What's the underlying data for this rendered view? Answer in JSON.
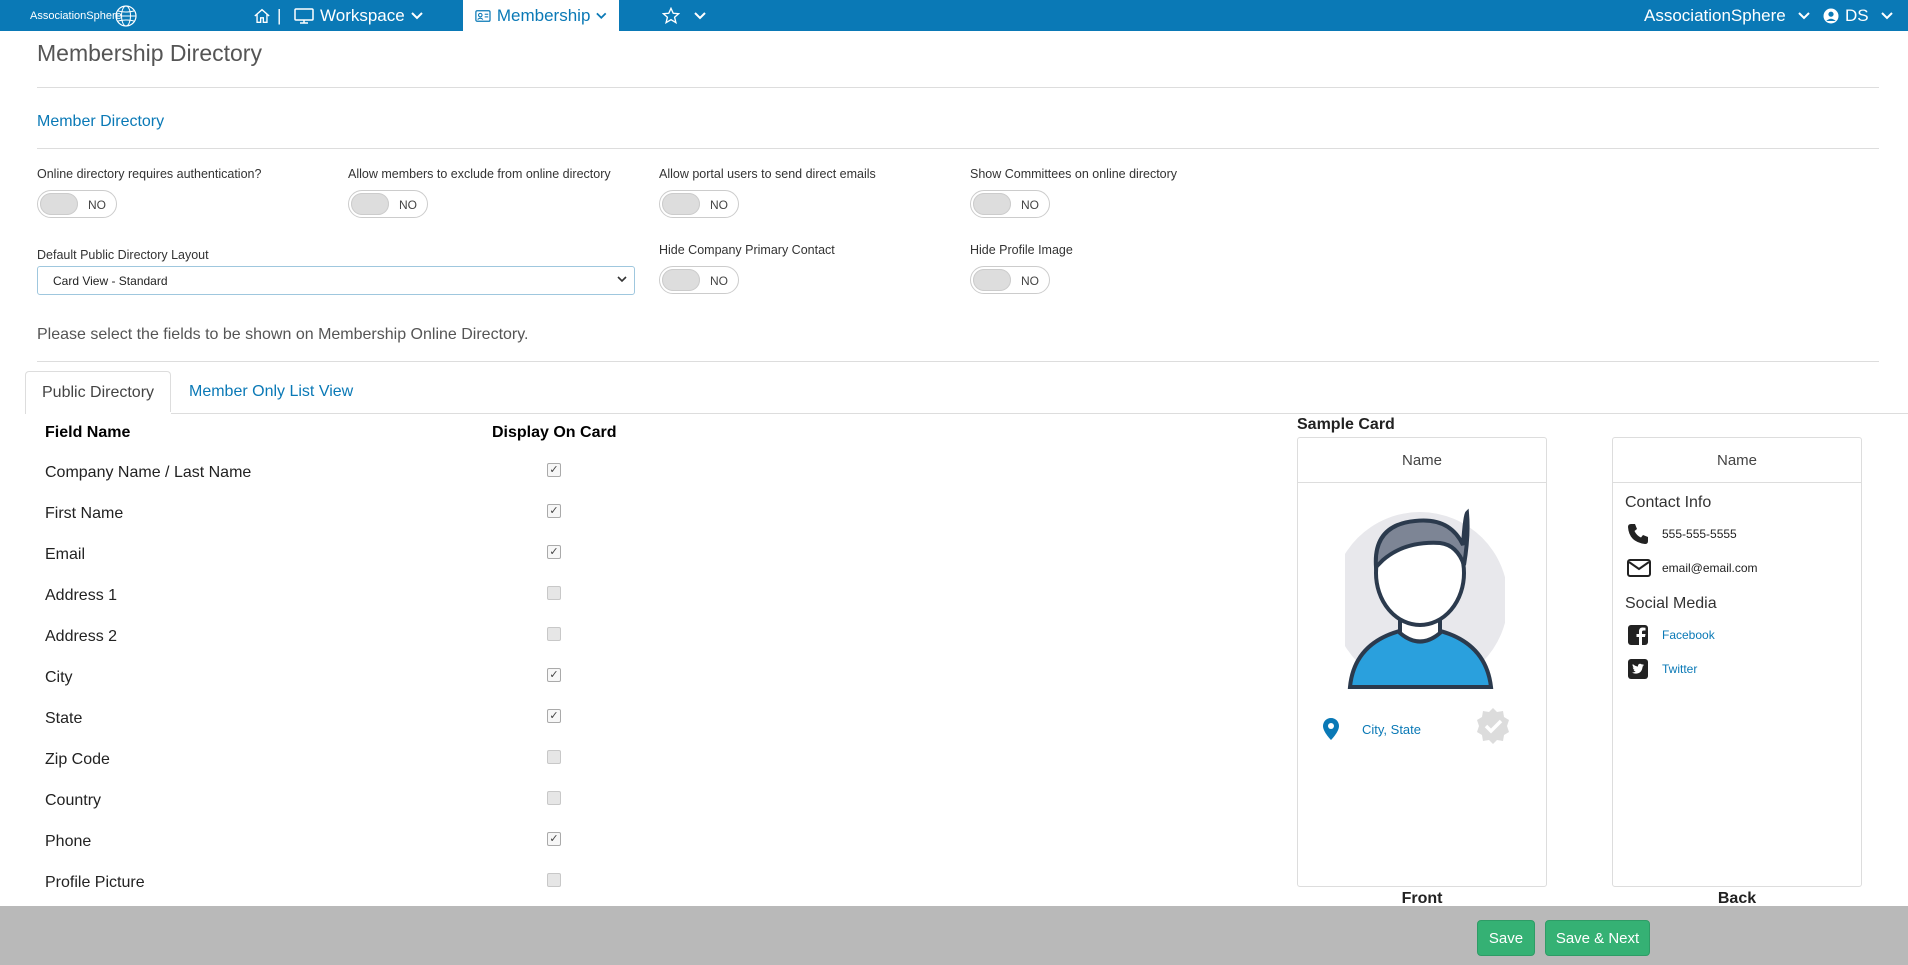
{
  "nav": {
    "logo_text": "AssociationSphere",
    "separator": "|",
    "workspace": "Workspace",
    "membership": "Membership",
    "org": "AssociationSphere",
    "user": "DS"
  },
  "page": {
    "title": "Membership Directory",
    "section": "Member Directory",
    "instructions": "Please select the fields to be shown on Membership Online Directory."
  },
  "options": [
    {
      "label": "Online directory requires authentication?",
      "state": "NO"
    },
    {
      "label": "Allow members to exclude from online directory",
      "state": "NO"
    },
    {
      "label": "Allow portal users to send direct emails",
      "state": "NO"
    },
    {
      "label": "Show Committees on online directory",
      "state": "NO"
    },
    {
      "label": "Hide Company Primary Contact",
      "state": "NO"
    },
    {
      "label": "Hide Profile Image",
      "state": "NO"
    }
  ],
  "layout_select": {
    "label": "Default Public Directory Layout",
    "value": "Card View - Standard"
  },
  "tabs": [
    "Public Directory",
    "Member Only List View"
  ],
  "table": {
    "headers": [
      "Field Name",
      "Display On Card"
    ],
    "rows": [
      {
        "name": "Company Name / Last Name",
        "checked": true
      },
      {
        "name": "First Name",
        "checked": true
      },
      {
        "name": "Email",
        "checked": true
      },
      {
        "name": "Address 1",
        "checked": false
      },
      {
        "name": "Address 2",
        "checked": false
      },
      {
        "name": "City",
        "checked": true
      },
      {
        "name": "State",
        "checked": true
      },
      {
        "name": "Zip Code",
        "checked": false
      },
      {
        "name": "Country",
        "checked": false
      },
      {
        "name": "Phone",
        "checked": true
      },
      {
        "name": "Profile Picture",
        "checked": false
      }
    ]
  },
  "sample_card": {
    "title": "Sample Card",
    "front_name": "Name",
    "back_name": "Name",
    "city_state": "City, State",
    "contact_heading": "Contact Info",
    "phone": "555-555-5555",
    "email": "email@email.com",
    "social_heading": "Social Media",
    "facebook": "Facebook",
    "twitter": "Twitter",
    "front_label": "Front",
    "back_label": "Back"
  },
  "footer": {
    "save": "Save",
    "save_next": "Save & Next"
  },
  "colors": {
    "brand": "#0a79b6",
    "button": "#35b174"
  }
}
